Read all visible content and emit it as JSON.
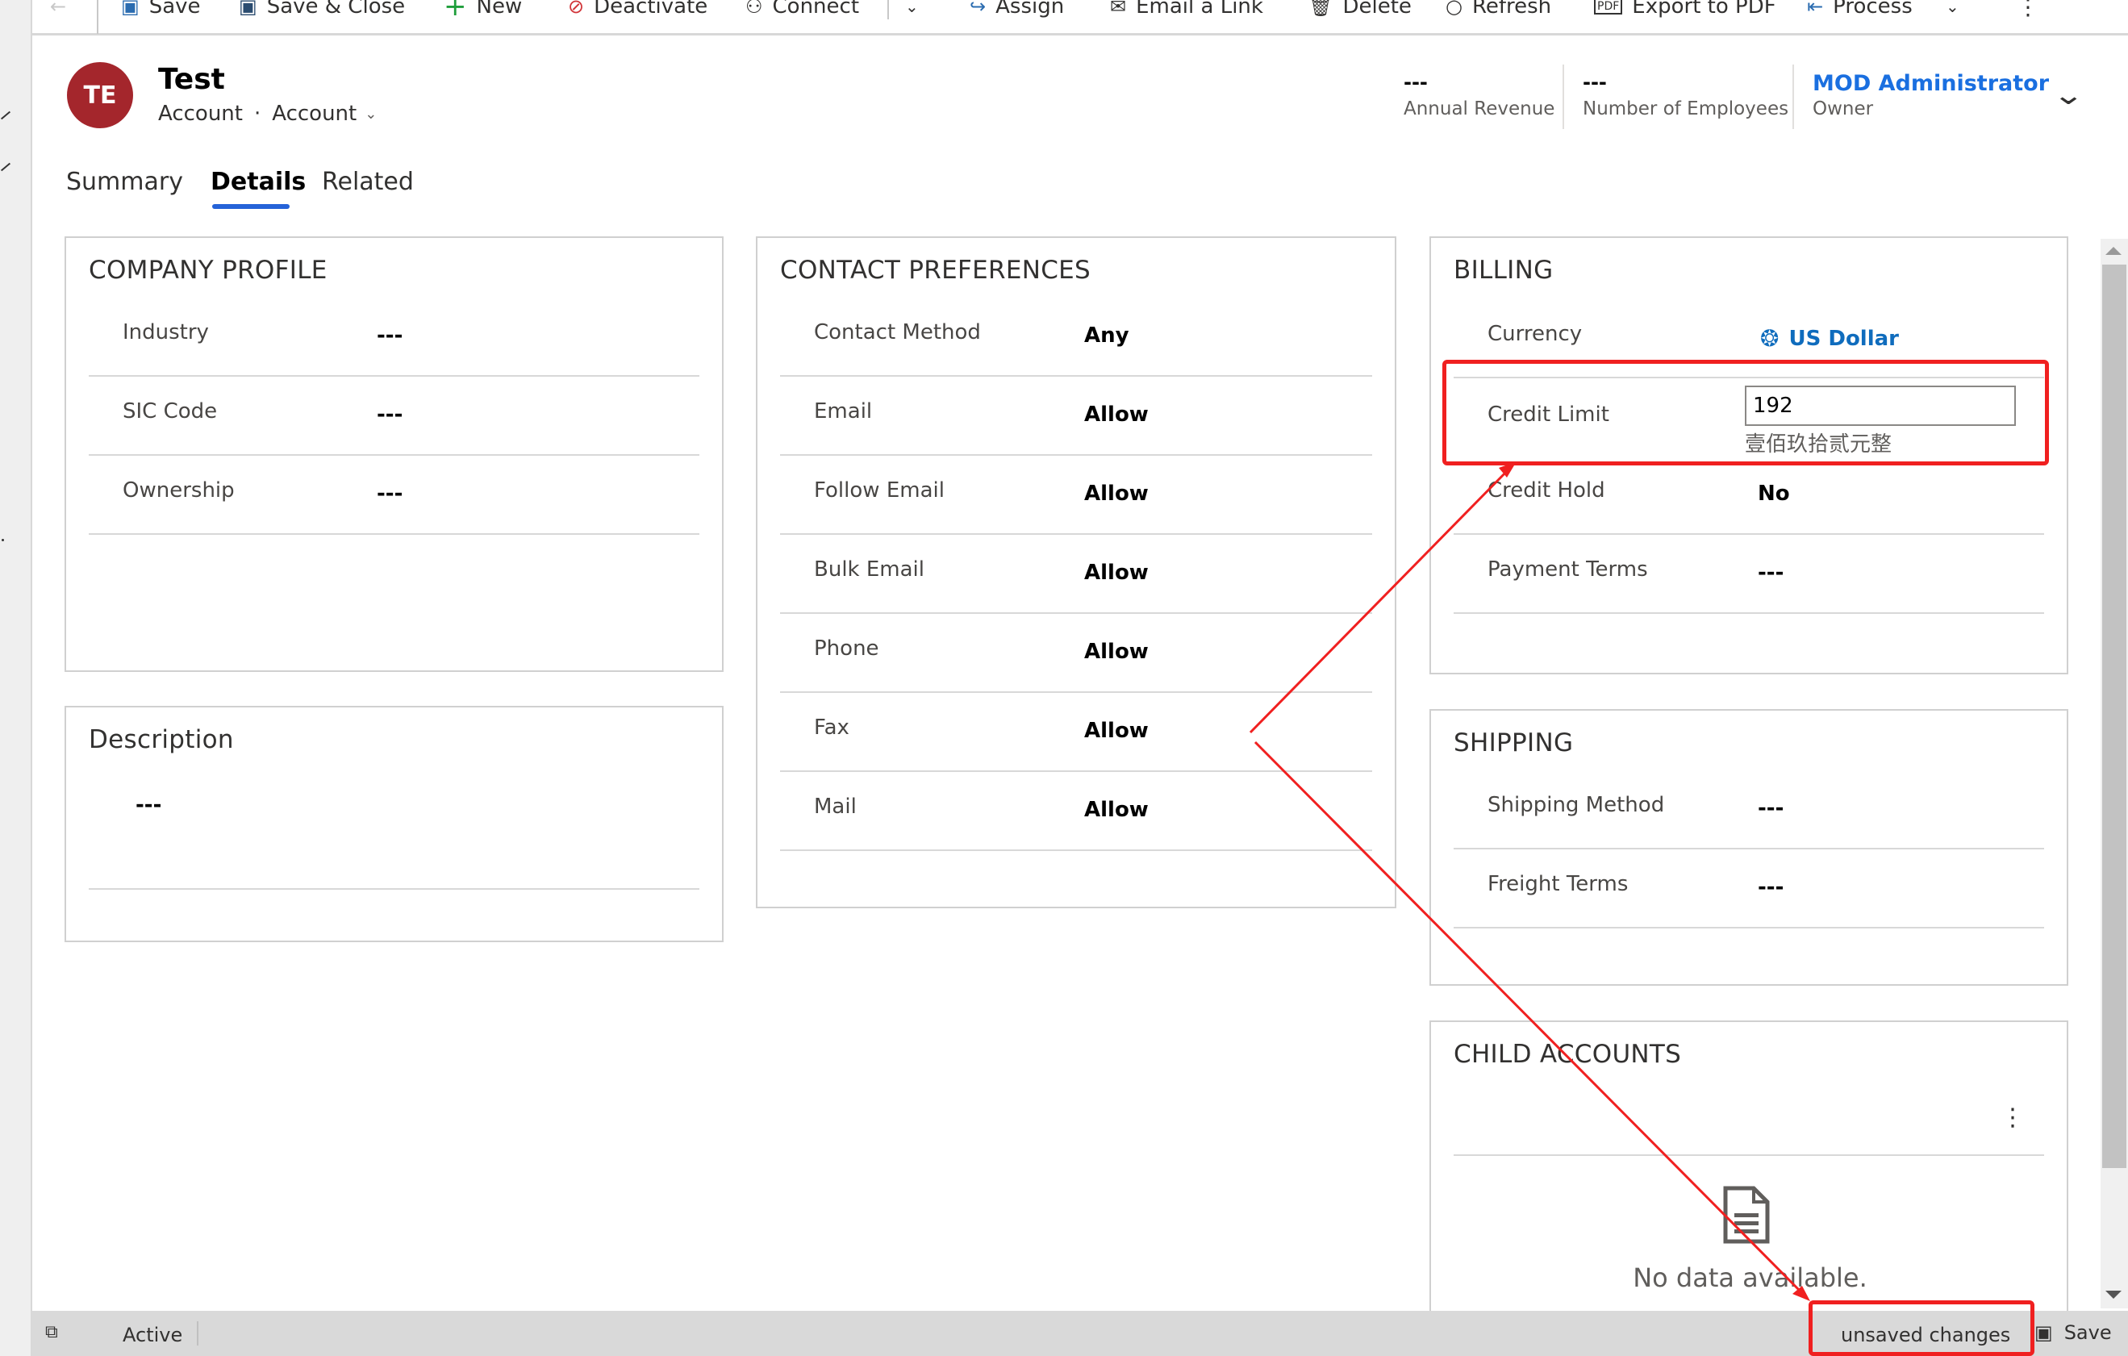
{
  "toolbar": {
    "back_icon": "back-arrow-icon",
    "items": [
      {
        "label": "Save",
        "icon": "save-icon"
      },
      {
        "label": "Save & Close",
        "icon": "save-close-icon"
      },
      {
        "label": "New",
        "icon": "plus-icon"
      },
      {
        "label": "Deactivate",
        "icon": "deactivate-icon"
      },
      {
        "label": "Connect",
        "icon": "connect-icon"
      },
      {
        "label": "Assign",
        "icon": "assign-icon"
      },
      {
        "label": "Email a Link",
        "icon": "email-link-icon"
      },
      {
        "label": "Delete",
        "icon": "delete-icon"
      },
      {
        "label": "Refresh",
        "icon": "refresh-icon"
      },
      {
        "label": "Export to PDF",
        "icon": "pdf-icon"
      },
      {
        "label": "Process",
        "icon": "process-icon"
      }
    ],
    "more_icon": "more-vertical-icon"
  },
  "header": {
    "avatar_initials": "TE",
    "avatar_color": "#a4262c",
    "title": "Test",
    "entity": "Account",
    "separator": "·",
    "form": "Account",
    "fields": [
      {
        "value": "---",
        "label": "Annual Revenue"
      },
      {
        "value": "---",
        "label": "Number of Employees"
      },
      {
        "value": "MOD Administrator",
        "label": "Owner"
      }
    ]
  },
  "tabs": [
    {
      "label": "Summary",
      "active": false
    },
    {
      "label": "Details",
      "active": true
    },
    {
      "label": "Related",
      "active": false
    }
  ],
  "company_profile": {
    "title": "COMPANY PROFILE",
    "rows": [
      {
        "label": "Industry",
        "value": "---"
      },
      {
        "label": "SIC Code",
        "value": "---"
      },
      {
        "label": "Ownership",
        "value": "---"
      }
    ]
  },
  "description": {
    "title": "Description",
    "value": "---"
  },
  "contact_preferences": {
    "title": "CONTACT PREFERENCES",
    "rows": [
      {
        "label": "Contact Method",
        "value": "Any"
      },
      {
        "label": "Email",
        "value": "Allow"
      },
      {
        "label": "Follow Email",
        "value": "Allow"
      },
      {
        "label": "Bulk Email",
        "value": "Allow"
      },
      {
        "label": "Phone",
        "value": "Allow"
      },
      {
        "label": "Fax",
        "value": "Allow"
      },
      {
        "label": "Mail",
        "value": "Allow"
      }
    ]
  },
  "billing": {
    "title": "BILLING",
    "currency_label": "Currency",
    "currency_value": "US Dollar",
    "credit_limit_label": "Credit Limit",
    "credit_limit_value": "192",
    "credit_limit_chinese": "壹佰玖拾贰元整",
    "rows": [
      {
        "label": "Credit Hold",
        "value": "No"
      },
      {
        "label": "Payment Terms",
        "value": "---"
      }
    ]
  },
  "shipping": {
    "title": "SHIPPING",
    "rows": [
      {
        "label": "Shipping Method",
        "value": "---"
      },
      {
        "label": "Freight Terms",
        "value": "---"
      }
    ]
  },
  "child_accounts": {
    "title": "CHILD ACCOUNTS",
    "empty_text": "No data available."
  },
  "status_bar": {
    "status": "Active",
    "unsaved": "unsaved changes",
    "save_label": "Save"
  },
  "colors": {
    "accent": "#2563d8",
    "link": "#0f6cbd",
    "annotation": "#f02020"
  }
}
